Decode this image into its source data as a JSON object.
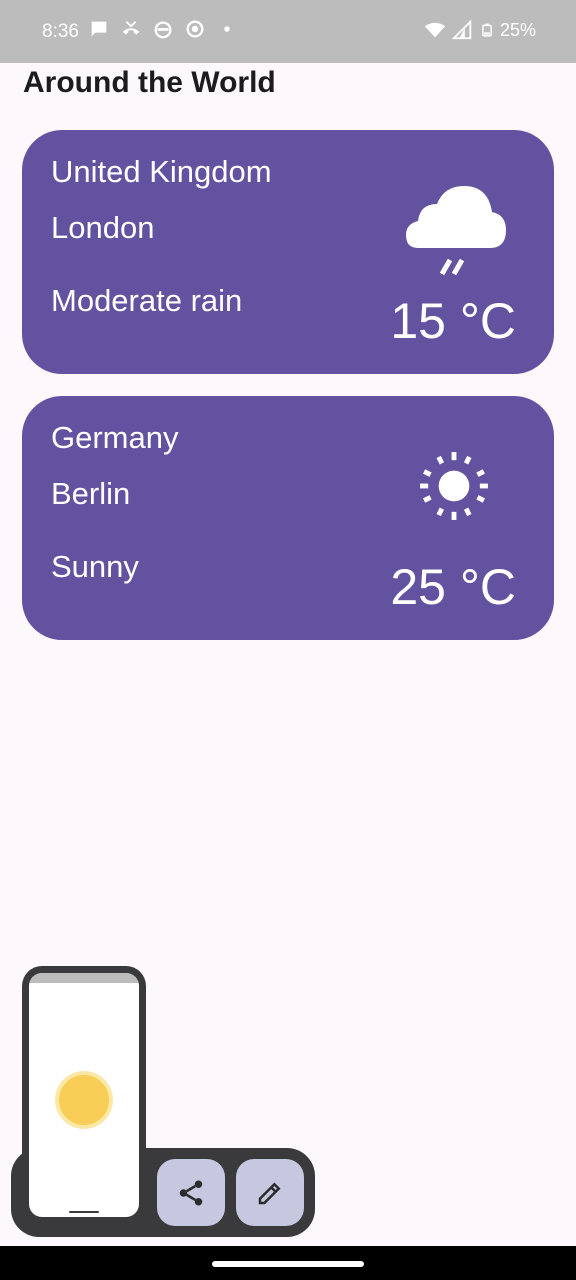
{
  "status_bar": {
    "time": "8:36",
    "battery": "25%",
    "left_icons": [
      "chat-bubble-icon",
      "missed-call-icon",
      "android-head-icon",
      "record-icon",
      "dot-icon"
    ],
    "right_icons": [
      "wifi-icon",
      "cell-signal-icon",
      "battery-icon"
    ]
  },
  "section": {
    "title": "Around the World"
  },
  "cards": [
    {
      "country": "United Kingdom",
      "city": "London",
      "condition": "Moderate rain",
      "temperature": "15 °C",
      "icon": "rain-cloud-icon"
    },
    {
      "country": "Germany",
      "city": "Berlin",
      "condition": "Sunny",
      "temperature": "25 °C",
      "icon": "sun-icon"
    }
  ],
  "screenshot_preview": {
    "actions": [
      "share-icon",
      "edit-pencil-icon"
    ]
  },
  "colors": {
    "card_bg": "#6352a0",
    "page_bg": "#fcf8fc",
    "status_bar_bg": "#bdbcbd",
    "pill_bg": "#3a3a3d",
    "pill_button_bg": "#c5c8de",
    "sun_yellow": "#f7cd55"
  }
}
